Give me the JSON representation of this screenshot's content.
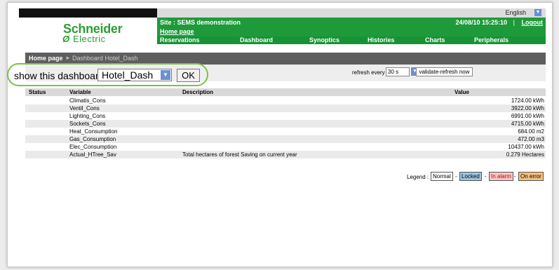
{
  "header": {
    "language": "English",
    "logo_line1": "Schneider",
    "logo_line2": "Electric",
    "site": "Site : SEMS demonstration",
    "home_link": "Home page",
    "datetime": "24/08/10 15:25:10",
    "separator": "|",
    "logout": "Logout"
  },
  "menu": [
    "Reservations",
    "Dashboard",
    "Synoptics",
    "Histories",
    "Charts",
    "Peripherals"
  ],
  "breadcrumb": {
    "home": "Home page",
    "current": "Dashboard Hotel_Dash"
  },
  "dashboard_select": {
    "label": "show this dashboard",
    "value": "Hotel_Dash",
    "ok": "OK"
  },
  "refresh": {
    "label": "refresh every",
    "value": "30 s",
    "button": "validate-refresh now"
  },
  "table": {
    "columns": [
      "Status",
      "Variable",
      "Description",
      "Value"
    ],
    "rows": [
      {
        "variable": "Climatis_Cons",
        "description": "",
        "value": "1724.00 kWh"
      },
      {
        "variable": "Ventil_Cons",
        "description": "",
        "value": "3922.00 kWh"
      },
      {
        "variable": "Lighting_Cons",
        "description": "",
        "value": "6991.00 kWh"
      },
      {
        "variable": "Sockets_Cons",
        "description": "",
        "value": "4715.00 kWh"
      },
      {
        "variable": "Heat_Consumption",
        "description": "",
        "value": "684.00 m2"
      },
      {
        "variable": "Gas_Consumption",
        "description": "",
        "value": "472.00 m3"
      },
      {
        "variable": "Elec_Consumption",
        "description": "",
        "value": "10437.00 kWh"
      },
      {
        "variable": "Actual_HTree_Sav",
        "description": "Total hectares of forest Saving on current year",
        "value": "0.279 Hectares"
      }
    ]
  },
  "legend": {
    "label": "Legend :",
    "dash": "-",
    "items": [
      {
        "label": "Normal",
        "color": "#ffffff",
        "text": "#000000"
      },
      {
        "label": "Locked",
        "color": "#9ec3df",
        "text": "#000000"
      },
      {
        "label": "In alarm",
        "color": "#f6c6c6",
        "text": "#cc0000"
      },
      {
        "label": "On error",
        "color": "#f5c07a",
        "text": "#000000"
      }
    ]
  },
  "colors": {
    "brand_green": "#1f9a3b",
    "highlight_green": "#7ec04a"
  }
}
